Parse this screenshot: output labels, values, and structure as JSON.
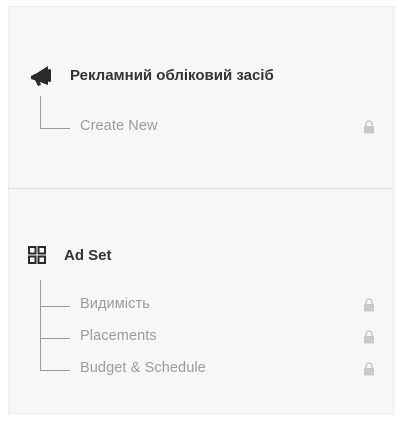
{
  "account_section": {
    "title": "Рекламний обліковий засіб",
    "icon": "megaphone-icon",
    "items": [
      {
        "label": "Create New",
        "status_icon": "lock-icon"
      }
    ]
  },
  "adset_section": {
    "title": "Ad Set",
    "icon": "grid-icon",
    "items": [
      {
        "label": "Видимість",
        "status_icon": "lock-icon"
      },
      {
        "label": "Placements",
        "status_icon": "lock-icon"
      },
      {
        "label": "Budget & Schedule",
        "status_icon": "lock-icon"
      }
    ]
  },
  "colors": {
    "panel_bg": "#f7f7f7",
    "title_text": "#333333",
    "item_text": "#9b9b9b",
    "tree_line": "#9a9a9a",
    "lock": "#c8c8c8"
  }
}
